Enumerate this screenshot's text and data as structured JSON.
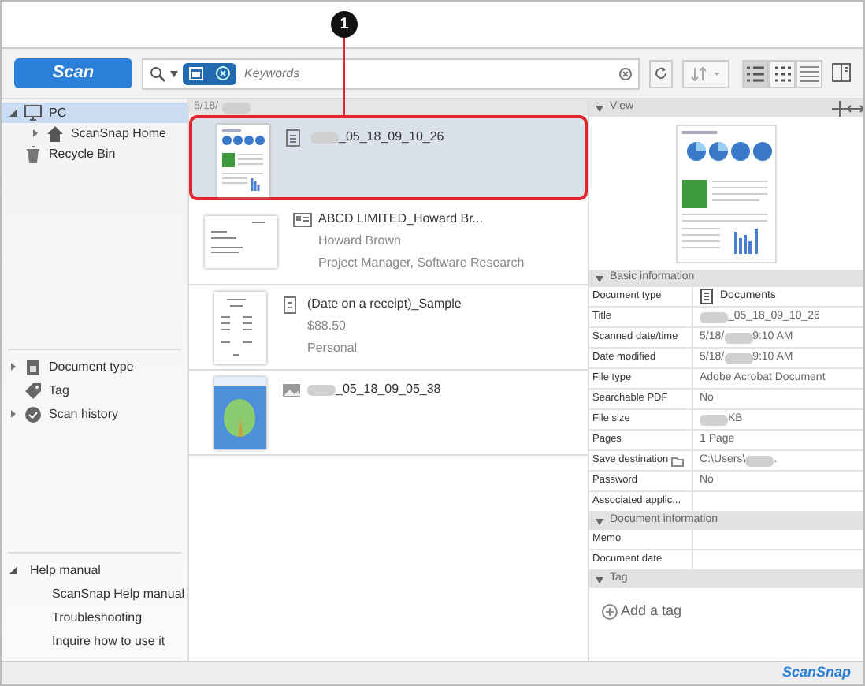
{
  "callout": {
    "number": "1"
  },
  "toolbar": {
    "scan_button": "Scan",
    "search": {
      "placeholder": "Keywords"
    },
    "views": [
      {
        "kind": "list",
        "selected": true
      },
      {
        "kind": "thumbs",
        "selected": false
      },
      {
        "kind": "lines",
        "selected": false
      }
    ]
  },
  "sidebar": {
    "items": [
      {
        "label": "PC",
        "kind": "pc",
        "selected": true,
        "expanded": true,
        "children": [
          {
            "label": "ScanSnap Home",
            "kind": "home",
            "selected": false,
            "expanded": false
          }
        ]
      },
      {
        "label": "Recycle Bin",
        "kind": "trash",
        "selected": false
      }
    ],
    "filters": [
      {
        "label": "Document type",
        "kind": "doctype",
        "expandable": true
      },
      {
        "label": "Tag",
        "kind": "tag",
        "expandable": false
      },
      {
        "label": "Scan history",
        "kind": "history",
        "expandable": true
      }
    ],
    "help": {
      "label": "Help manual",
      "expanded": true,
      "items": [
        "ScanSnap Help manual",
        "Troubleshooting",
        "Inquire how to use it"
      ]
    }
  },
  "list": {
    "date_header": [
      {
        "kind": "text",
        "text": "5/18/"
      },
      {
        "kind": "redacted"
      }
    ],
    "records": [
      {
        "kind": "document",
        "selected": true,
        "title": [
          {
            "kind": "redacted"
          },
          {
            "kind": "text",
            "text": "_05_18_09_10_26"
          }
        ]
      },
      {
        "kind": "card",
        "selected": false,
        "title": [
          {
            "kind": "text",
            "text": "ABCD LIMITED_Howard Br..."
          }
        ],
        "lines": [
          "Howard Brown",
          "Project Manager, Software Research"
        ]
      },
      {
        "kind": "receipt",
        "selected": false,
        "title": [
          {
            "kind": "text",
            "text": "(Date on a receipt)_Sample"
          }
        ],
        "lines": [
          "$88.50",
          "Personal"
        ]
      },
      {
        "kind": "photo",
        "selected": false,
        "title": [
          {
            "kind": "redacted"
          },
          {
            "kind": "text",
            "text": "_05_18_09_05_38"
          }
        ]
      }
    ]
  },
  "details": {
    "view_header": "View",
    "sections": [
      {
        "title": "Basic information",
        "rows": [
          {
            "label": "Document type",
            "kind": "icon_value",
            "value": [
              {
                "kind": "text",
                "text": "Documents"
              }
            ]
          },
          {
            "label": "Title",
            "kind": "plain",
            "value": [
              {
                "kind": "redacted"
              },
              {
                "kind": "text",
                "text": "_05_18_09_10_26"
              }
            ]
          },
          {
            "label": "Scanned date/time",
            "kind": "plain",
            "value": [
              {
                "kind": "text",
                "text": "5/18/"
              },
              {
                "kind": "redacted"
              },
              {
                "kind": "text",
                "text": "9:10 AM"
              }
            ]
          },
          {
            "label": "Date modified",
            "kind": "plain",
            "value": [
              {
                "kind": "text",
                "text": "5/18/"
              },
              {
                "kind": "redacted"
              },
              {
                "kind": "text",
                "text": "9:10 AM"
              }
            ]
          },
          {
            "label": "File type",
            "kind": "plain",
            "value": [
              {
                "kind": "text",
                "text": "Adobe Acrobat Document"
              }
            ]
          },
          {
            "label": "Searchable PDF",
            "kind": "plain",
            "value": [
              {
                "kind": "text",
                "text": "No"
              }
            ]
          },
          {
            "label": "File size",
            "kind": "plain",
            "value": [
              {
                "kind": "redacted"
              },
              {
                "kind": "text",
                "text": "KB"
              }
            ]
          },
          {
            "label": "Pages",
            "kind": "plain",
            "value": [
              {
                "kind": "text",
                "text": "1 Page"
              }
            ]
          },
          {
            "label": "Save destination",
            "kind": "folder",
            "value": [
              {
                "kind": "text",
                "text": "C:\\Users\\"
              },
              {
                "kind": "redacted"
              },
              {
                "kind": "text",
                "text": "."
              }
            ]
          },
          {
            "label": "Password",
            "kind": "plain",
            "value": [
              {
                "kind": "text",
                "text": "No"
              }
            ]
          },
          {
            "label": "Associated applic...",
            "kind": "plain"
          }
        ]
      },
      {
        "title": "Document information",
        "rows": [
          {
            "label": "Memo",
            "kind": "plain"
          },
          {
            "label": "Document date",
            "kind": "plain"
          }
        ]
      },
      {
        "title": "Tag"
      }
    ],
    "add_tag": "Add a tag"
  },
  "status_bar": {
    "logo": "ScanSnap"
  }
}
